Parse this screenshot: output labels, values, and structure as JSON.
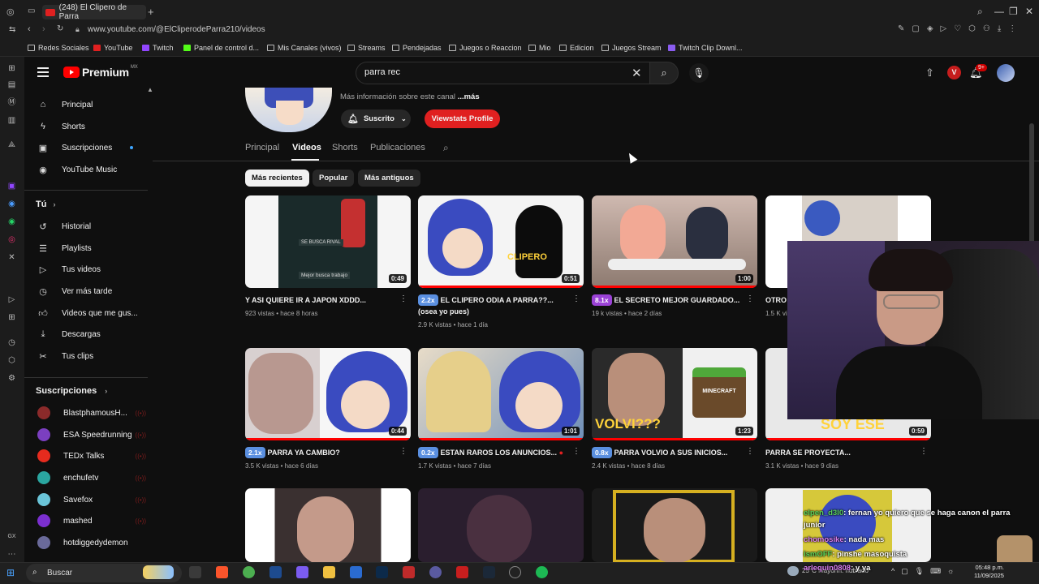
{
  "browser": {
    "tab_title": "(248) El Clipero de Parra",
    "url": "www.youtube.com/@ElCliperodeParra210/videos",
    "new_tab": "+",
    "bookmarks": [
      {
        "label": "Redes Sociales"
      },
      {
        "label": "YouTube"
      },
      {
        "label": "Twitch"
      },
      {
        "label": "Panel de control d..."
      },
      {
        "label": "Mis Canales (vivos)"
      },
      {
        "label": "Streams"
      },
      {
        "label": "Pendejadas"
      },
      {
        "label": "Juegos o Reaccion"
      },
      {
        "label": "Mio"
      },
      {
        "label": "Edicion"
      },
      {
        "label": "Juegos Stream"
      },
      {
        "label": "Twitch Clip Downl..."
      }
    ]
  },
  "header": {
    "logo_text": "Premium",
    "region": "MX",
    "search_value": "parra rec",
    "notif_count": "9+",
    "v_badge": "V"
  },
  "sidebar": {
    "main": [
      {
        "label": "Principal",
        "icon": "home-icon"
      },
      {
        "label": "Shorts",
        "icon": "shorts-icon"
      },
      {
        "label": "Suscripciones",
        "icon": "subscriptions-icon"
      },
      {
        "label": "YouTube Music",
        "icon": "music-icon"
      }
    ],
    "you_title": "Tú",
    "you": [
      {
        "label": "Historial",
        "icon": "history-icon"
      },
      {
        "label": "Playlists",
        "icon": "playlists-icon"
      },
      {
        "label": "Tus videos",
        "icon": "your-videos-icon"
      },
      {
        "label": "Ver más tarde",
        "icon": "watch-later-icon"
      },
      {
        "label": "Videos que me gus...",
        "icon": "like-icon"
      },
      {
        "label": "Descargas",
        "icon": "download-icon"
      },
      {
        "label": "Tus clips",
        "icon": "clips-icon"
      }
    ],
    "subs_title": "Suscripciones",
    "subs": [
      {
        "label": "BlastphamousH...",
        "color": "#8b2a2a"
      },
      {
        "label": "ESA Speedrunning",
        "color": "#7b3fc0"
      },
      {
        "label": "TEDx Talks",
        "color": "#e62b1e"
      },
      {
        "label": "enchufetv",
        "color": "#2aa6a0"
      },
      {
        "label": "Savefox",
        "color": "#6ac4d8"
      },
      {
        "label": "mashed",
        "color": "#7b2fd0"
      },
      {
        "label": "hotdiggedydemon",
        "color": "#6a6a9a"
      }
    ]
  },
  "channel": {
    "more_info": "Más información sobre este canal",
    "more": "...más",
    "subscribed": "Suscrito",
    "viewstats": "Viewstats Profile",
    "tabs": [
      "Principal",
      "Videos",
      "Shorts",
      "Publicaciones"
    ],
    "chips": [
      "Más recientes",
      "Popular",
      "Más antiguos"
    ]
  },
  "videos": [
    {
      "title": "Y ASI QUIERE IR A JAPON XDDD...",
      "speed": "",
      "meta": "923 vistas • hace 8 horas",
      "duration": "0:49",
      "progress": 0
    },
    {
      "title": "EL CLIPERO ODIA A PARRA??... (osea yo pues)",
      "speed": "2.2x",
      "meta": "2.9 K vistas • hace 1 día",
      "duration": "0:51",
      "progress": 1.0
    },
    {
      "title": "EL SECRETO MEJOR GUARDADO...",
      "speed": "8.1x",
      "meta": "19 k vistas • hace 2 días",
      "duration": "1:00",
      "progress": 1.0
    },
    {
      "title": "OTRO",
      "speed": "",
      "meta": "1.5 K vi",
      "duration": "",
      "progress": 0
    },
    {
      "title": "PARRA YA CAMBIO?",
      "speed": "2.1x",
      "meta": "3.5 K vistas • hace 6 días",
      "duration": "0:44",
      "progress": 1.0
    },
    {
      "title": "ESTAN RAROS LOS ANUNCIOS...",
      "speed": "0.2x",
      "meta": "1.7 K vistas • hace 7 días",
      "duration": "1:01",
      "progress": 1.0
    },
    {
      "title": "PARRA VOLVIO A SUS INICIOS...",
      "speed": "0.8x",
      "meta": "2.4 K vistas • hace 8 días",
      "duration": "1:23",
      "progress": 1.0
    },
    {
      "title": "PARRA SE PROYECTA...",
      "speed": "",
      "meta": "3.1 K vistas • hace 9 días",
      "duration": "0:59",
      "progress": 1.0
    }
  ],
  "thumb_texts": {
    "t1a": "SE BUSCA RIVAL",
    "t1b": "Mejor busca trabajo",
    "t2": "CLIPERO",
    "t7": "VOLVI???",
    "t7b": "MINECRAFT",
    "t8": "SOY ESE"
  },
  "chat": [
    {
      "user": "elpen_d3l0",
      "msg": ": fernan yo quiero que se haga canon el parra"
    },
    {
      "user": "",
      "msg": "junior"
    },
    {
      "user": "chomosike",
      "msg": ": nada mas"
    },
    {
      "user": "ismOFF",
      "msg": ": pinshe masoquista"
    },
    {
      "user": "arlequin0808",
      "msg": ": y ya"
    }
  ],
  "taskbar": {
    "search": "Buscar",
    "weather": "25°C  Mayorm. nublado",
    "time": "05:48 p.m.",
    "date": "11/09/2025"
  }
}
